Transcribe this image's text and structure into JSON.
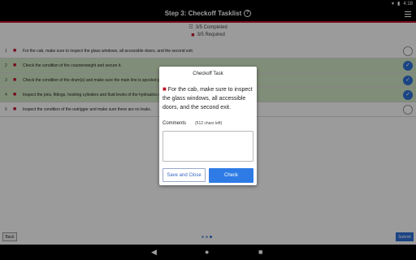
{
  "status_bar": {
    "time": "4:18"
  },
  "header": {
    "title": "Step 3: Checkoff Tasklist",
    "help_icon": "question-circle-icon",
    "menu_icon": "hamburger-menu-icon"
  },
  "summary": {
    "completed": "3/5 Completed",
    "required": "3/5 Required"
  },
  "tasks": [
    {
      "num": "1",
      "text": "For the cab, make sure to inspect the glass windows, all accessible doors, and the second exit.",
      "done": false
    },
    {
      "num": "2",
      "text": "Check the condition of the counterweight and secure it.",
      "done": true
    },
    {
      "num": "3",
      "text": "Check the condition of the drum(s) and make sure the main line is spooled prope",
      "done": true
    },
    {
      "num": "4",
      "text": "Inspect the pins, fittings, hoisting cylinders and fluid levels of the hydraulics syst",
      "done": true
    },
    {
      "num": "5",
      "text": "Inspect the condition of the outrigger and make sure there are no leaks.",
      "done": false
    }
  ],
  "dialog": {
    "title": "Checkoff Task",
    "task_text": "For the cab, make sure to inspect the glass windows, all accessible doors, and the second exit.",
    "comments_label": "Comments",
    "chars_left": "(512 chars left)",
    "comment_value": "",
    "save_close_label": "Save and Close",
    "check_label": "Check"
  },
  "footer": {
    "back_label": "Back",
    "submit_label": "Submit",
    "page_dots": 3,
    "active_dot": 2
  },
  "colors": {
    "accent_red": "#c0122b",
    "primary_blue": "#2e7be6",
    "done_green": "#cfe6c3"
  }
}
